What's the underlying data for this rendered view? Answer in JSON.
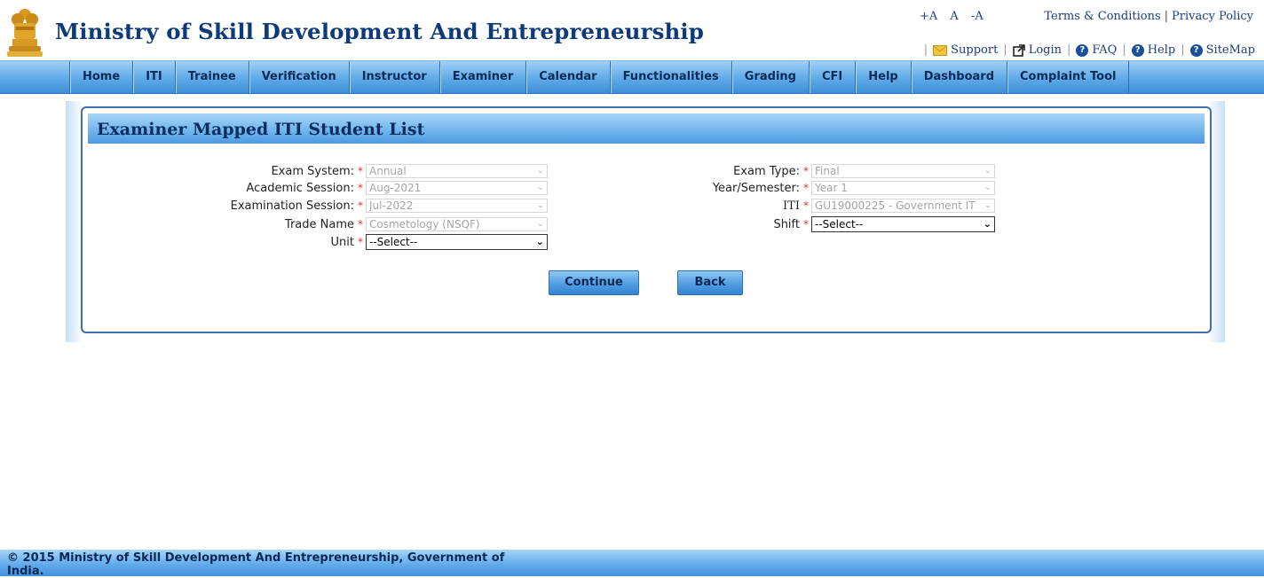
{
  "header": {
    "title": "Ministry of Skill Development And Entrepreneurship",
    "font_controls": [
      "+A",
      "A",
      "-A"
    ],
    "top_links": [
      "Terms & Conditions",
      "Privacy Policy"
    ],
    "top_separator": "|",
    "util_links": {
      "support": "Support",
      "login": "Login",
      "faq": "FAQ",
      "help": "Help",
      "sitemap": "SiteMap"
    }
  },
  "nav": {
    "items": [
      "Home",
      "ITI",
      "Trainee",
      "Verification",
      "Instructor",
      "Examiner",
      "Calendar",
      "Functionalities",
      "Grading",
      "CFI",
      "Help",
      "Dashboard",
      "Complaint Tool"
    ]
  },
  "form": {
    "title": "Examiner Mapped ITI Student List",
    "required_mark": "*",
    "left": [
      {
        "label": "Exam System:",
        "value": "Annual",
        "enabled": false
      },
      {
        "label": "Academic Session:",
        "value": "Aug-2021",
        "enabled": false
      },
      {
        "label": "Examination Session:",
        "value": "Jul-2022",
        "enabled": false
      },
      {
        "label": "Trade Name",
        "value": "Cosmetology (NSQF)",
        "enabled": false
      },
      {
        "label": "Unit",
        "value": "--Select--",
        "enabled": true
      }
    ],
    "right": [
      {
        "label": "Exam Type:",
        "value": "Final",
        "enabled": false
      },
      {
        "label": "Year/Semester:",
        "value": "Year 1",
        "enabled": false
      },
      {
        "label": "ITI",
        "value": "GU19000225 - Government IT",
        "enabled": false
      },
      {
        "label": "Shift",
        "value": "--Select--",
        "enabled": true
      }
    ],
    "buttons": {
      "continue": "Continue",
      "back": "Back"
    }
  },
  "footer": {
    "text": "© 2015 Ministry of Skill Development And Entrepreneurship, Government of India."
  },
  "colors": {
    "title_blue": "#0d3a7a",
    "nav_gradient": "#5ea9e8",
    "required": "#e03030",
    "panel_border": "#3f6fb0"
  }
}
